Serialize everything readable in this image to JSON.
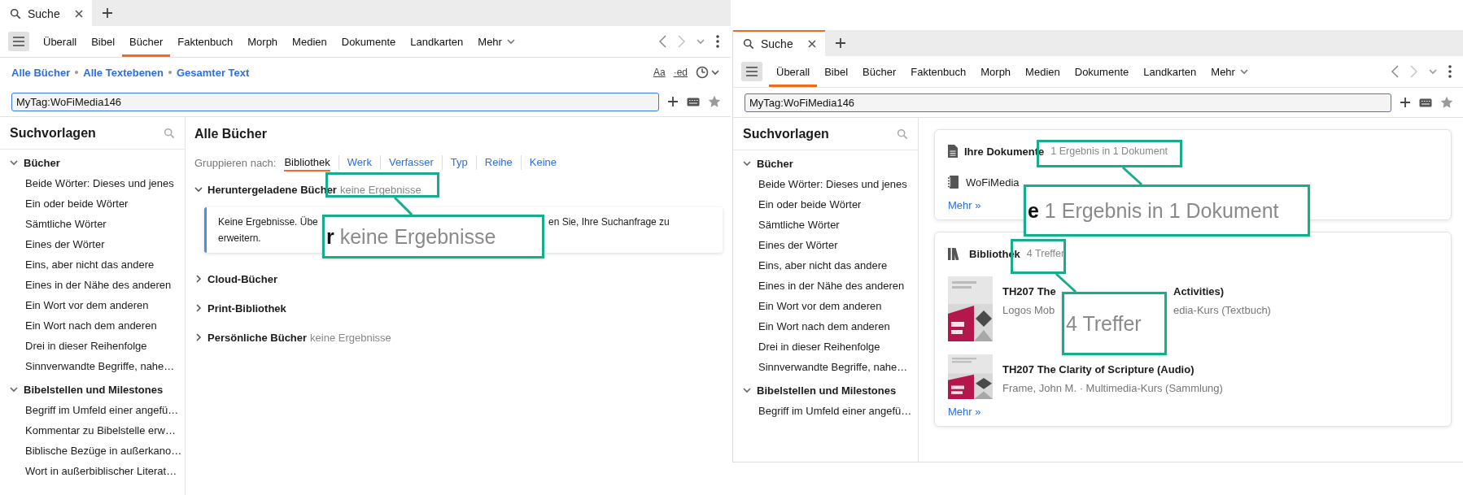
{
  "windows": [
    {
      "focused": false,
      "tabs": [
        {
          "label": "Suche",
          "selected": true
        }
      ],
      "nav": [
        {
          "label": "Überall",
          "selected": false
        },
        {
          "label": "Bibel",
          "selected": false
        },
        {
          "label": "Bücher",
          "selected": true
        },
        {
          "label": "Faktenbuch",
          "selected": false
        },
        {
          "label": "Morph",
          "selected": false
        },
        {
          "label": "Medien",
          "selected": false
        },
        {
          "label": "Dokumente",
          "selected": false
        },
        {
          "label": "Landkarten",
          "selected": false
        }
      ],
      "more_label": "Mehr",
      "scope": [
        "Alle Bücher",
        "Alle Textebenen",
        "Gesamter Text"
      ],
      "tools": [
        "Aa",
        "·ed"
      ],
      "search": {
        "value": "MyTag:WoFiMedia146"
      },
      "sidebar": {
        "title": "Suchvorlagen",
        "groups": [
          {
            "label": "Bücher",
            "expanded": true,
            "items": [
              "Beide Wörter: Dieses und jenes",
              "Ein oder beide Wörter",
              "Sämtliche Wörter",
              "Eines der Wörter",
              "Eins, aber nicht das andere",
              "Eines in der Nähe des anderen",
              "Ein Wort vor dem anderen",
              "Ein Wort nach dem anderen",
              "Drei in dieser Reihenfolge",
              "Sinnverwandte Begriffe, nahe…"
            ]
          },
          {
            "label": "Bibelstellen und Milestones",
            "expanded": true,
            "items": [
              "Begriff im Umfeld einer angefü…",
              "Kommentar zu Bibelstelle erw…",
              "Biblische Bezüge in außerkano…",
              "Wort in außerbiblischer Literat…"
            ]
          }
        ]
      },
      "content": {
        "kind": "books",
        "title": "Alle Bücher",
        "group_label": "Gruppieren nach:",
        "group_options": [
          {
            "label": "Bibliothek",
            "selected": true
          },
          {
            "label": "Werk",
            "selected": false
          },
          {
            "label": "Verfasser",
            "selected": false
          },
          {
            "label": "Typ",
            "selected": false
          },
          {
            "label": "Reihe",
            "selected": false
          },
          {
            "label": "Keine",
            "selected": false
          }
        ],
        "sections": [
          {
            "label": "Heruntergeladene Bücher",
            "expanded": true,
            "note": "keine Ergebnisse",
            "message": [
              "Keine Ergebnisse. Übe",
              "en Sie, Ihre Suchanfrage zu",
              "erweitern."
            ]
          },
          {
            "label": "Cloud-Bücher",
            "expanded": false
          },
          {
            "label": "Print-Bibliothek",
            "expanded": false
          },
          {
            "label": "Persönliche Bücher",
            "expanded": false,
            "note": "keine Ergebnisse"
          }
        ]
      }
    },
    {
      "focused": true,
      "tabs": [
        {
          "label": "Suche",
          "selected": true
        }
      ],
      "nav": [
        {
          "label": "Überall",
          "selected": true
        },
        {
          "label": "Bibel",
          "selected": false
        },
        {
          "label": "Bücher",
          "selected": false
        },
        {
          "label": "Faktenbuch",
          "selected": false
        },
        {
          "label": "Morph",
          "selected": false
        },
        {
          "label": "Medien",
          "selected": false
        },
        {
          "label": "Dokumente",
          "selected": false
        },
        {
          "label": "Landkarten",
          "selected": false
        }
      ],
      "more_label": "Mehr",
      "search": {
        "value": "MyTag:WoFiMedia146"
      },
      "sidebar": {
        "title": "Suchvorlagen",
        "groups": [
          {
            "label": "Bücher",
            "expanded": true,
            "items": [
              "Beide Wörter: Dieses und jenes",
              "Ein oder beide Wörter",
              "Sämtliche Wörter",
              "Eines der Wörter",
              "Eins, aber nicht das andere",
              "Eines in der Nähe des anderen",
              "Ein Wort vor dem anderen",
              "Ein Wort nach dem anderen",
              "Drei in dieser Reihenfolge",
              "Sinnverwandte Begriffe, nahe…"
            ]
          },
          {
            "label": "Bibelstellen und Milestones",
            "expanded": true,
            "items": [
              "Begriff im Umfeld einer angefü…"
            ]
          }
        ]
      },
      "content": {
        "kind": "overview",
        "cards": [
          {
            "kind": "documents",
            "title": "Ihre Dokumente",
            "note": "1 Ergebnis in 1 Dokument",
            "items": [
              {
                "title": "WoFiMedia"
              }
            ],
            "more": "Mehr »"
          },
          {
            "kind": "library",
            "title": "Bibliothek",
            "note": "4 Treffer",
            "books": [
              {
                "kind": "picture",
                "title": [
                  "TH207 The",
                  "Activities)"
                ],
                "subtitle": [
                  "Logos Mob",
                  "edia-Kurs (Textbuch)"
                ]
              },
              {
                "kind": "picture",
                "title": [
                  "TH207 The Clarity of Scripture (Audio)"
                ],
                "subtitle": [
                  "Frame, John M. · Multimedia-Kurs (Sammlung)"
                ]
              }
            ],
            "more": "Mehr »"
          }
        ]
      }
    }
  ],
  "callouts": [
    {
      "text": "**r** keine Ergebnisse"
    },
    {
      "text": "**e** 1 Ergebnis in 1 Dokument"
    },
    {
      "text": "4 Treffer"
    }
  ]
}
